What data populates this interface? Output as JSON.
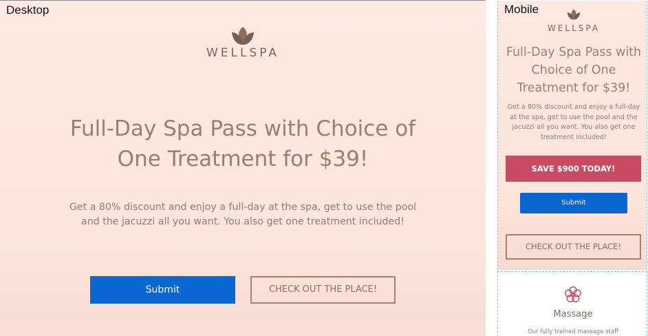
{
  "labels": {
    "desktop": "Desktop",
    "mobile": "Mobile"
  },
  "brand": {
    "name": "WELLSPA",
    "logo_icon": "lotus-icon"
  },
  "hero": {
    "headline": "Full-Day Spa Pass with Choice of One Treatment for $39!",
    "description": "Get a 80% discount and enjoy a full-day at the spa, get to use the pool and the jacuzzi all you want. You also get one treatment included!",
    "submit_label": "Submit",
    "secondary_label": "CHECK OUT THE PLACE!",
    "save_banner": "SAVE $900 TODAY!"
  },
  "service": {
    "icon": "flower-icon",
    "title": "Massage",
    "description": "Our fully trained massage staff"
  },
  "colors": {
    "background": "#fde9e1",
    "headline": "#9c7e70",
    "primary_button": "#0a66d1",
    "save_banner": "#c84a63",
    "outline": "#a28174",
    "flower": "#c84a63"
  }
}
